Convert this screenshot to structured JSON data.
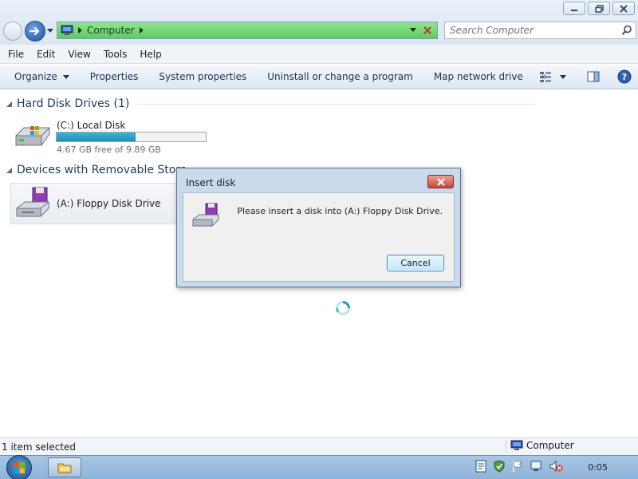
{
  "window": {
    "address": {
      "crumb": "Computer"
    },
    "search": {
      "placeholder": "Search Computer"
    }
  },
  "menu": {
    "items": [
      "File",
      "Edit",
      "View",
      "Tools",
      "Help"
    ]
  },
  "commands": {
    "organize": "Organize",
    "properties": "Properties",
    "system_properties": "System properties",
    "uninstall": "Uninstall or change a program",
    "map_drive": "Map network drive",
    "more": "»"
  },
  "groups": {
    "hard_disks": {
      "title": "Hard Disk Drives (1)"
    },
    "removable": {
      "title": "Devices with Removable Stora"
    }
  },
  "drives": {
    "c": {
      "name": "(C:) Local Disk",
      "free_text": "4.67 GB free of 9.89 GB",
      "used_fraction": 0.53
    },
    "a": {
      "name": "(A:) Floppy Disk Drive"
    }
  },
  "dialog": {
    "title": "Insert disk",
    "message": "Please insert a disk into (A:) Floppy Disk Drive.",
    "cancel_label": "Cancel"
  },
  "status": {
    "left": "1 item selected",
    "right": "Computer"
  },
  "taskbar": {
    "clock": "0:05"
  },
  "colors": {
    "address_bg": "#5ecb5e",
    "progress_fill": "#1b8fb9",
    "close_red": "#c9463a",
    "dialog_frame": "#c8daeb"
  },
  "icons": [
    "minimize-icon",
    "maximize-icon",
    "close-icon",
    "back-icon",
    "forward-icon",
    "computer-icon",
    "search-icon",
    "hard-drive-icon",
    "floppy-drive-icon",
    "view-options-icon",
    "preview-pane-icon",
    "help-icon",
    "windows-start-icon",
    "explorer-folder-icon",
    "flag-icon",
    "network-icon",
    "volume-muted-icon"
  ]
}
